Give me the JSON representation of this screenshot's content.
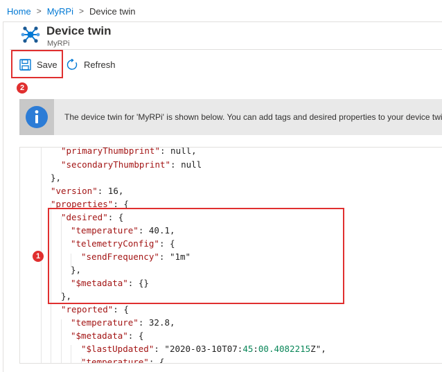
{
  "breadcrumb": {
    "items": [
      "Home",
      "MyRPi"
    ],
    "separator": ">",
    "current": "Device twin"
  },
  "header": {
    "title": "Device twin",
    "subtitle": "MyRPi",
    "icon": "device-twin-icon"
  },
  "toolbar": {
    "save_label": "Save",
    "refresh_label": "Refresh",
    "save_icon": "floppy-disk-icon",
    "refresh_icon": "refresh-icon"
  },
  "annotations": {
    "badge_1": "1",
    "badge_2": "2"
  },
  "info_bar": {
    "icon": "info-icon",
    "text": "The device twin for 'MyRPi' is shown below. You can add tags and desired properties to your device twin here."
  },
  "json_lines": [
    "\"primaryThumbprint\": null,",
    "\"secondaryThumbprint\": null",
    "},",
    "\"version\": 16,",
    "\"properties\": {",
    "\"desired\": {",
    "\"temperature\": 40.1,",
    "\"telemetryConfig\": {",
    "\"sendFrequency\": \"1m\"",
    "},",
    "\"$metadata\": {}",
    "},",
    "\"reported\": {",
    "\"temperature\": 32.8,",
    "\"$metadata\": {",
    "\"$lastUpdated\": \"2020-03-10T07:45:00.4082215Z\",",
    "\"temperature\": {"
  ],
  "colors": {
    "accent": "#0078d4",
    "highlight": "#e02f2f",
    "json_key": "#a31515",
    "json_string": "#0451a5",
    "json_number": "#098658",
    "json_literal": "#0000ff"
  }
}
